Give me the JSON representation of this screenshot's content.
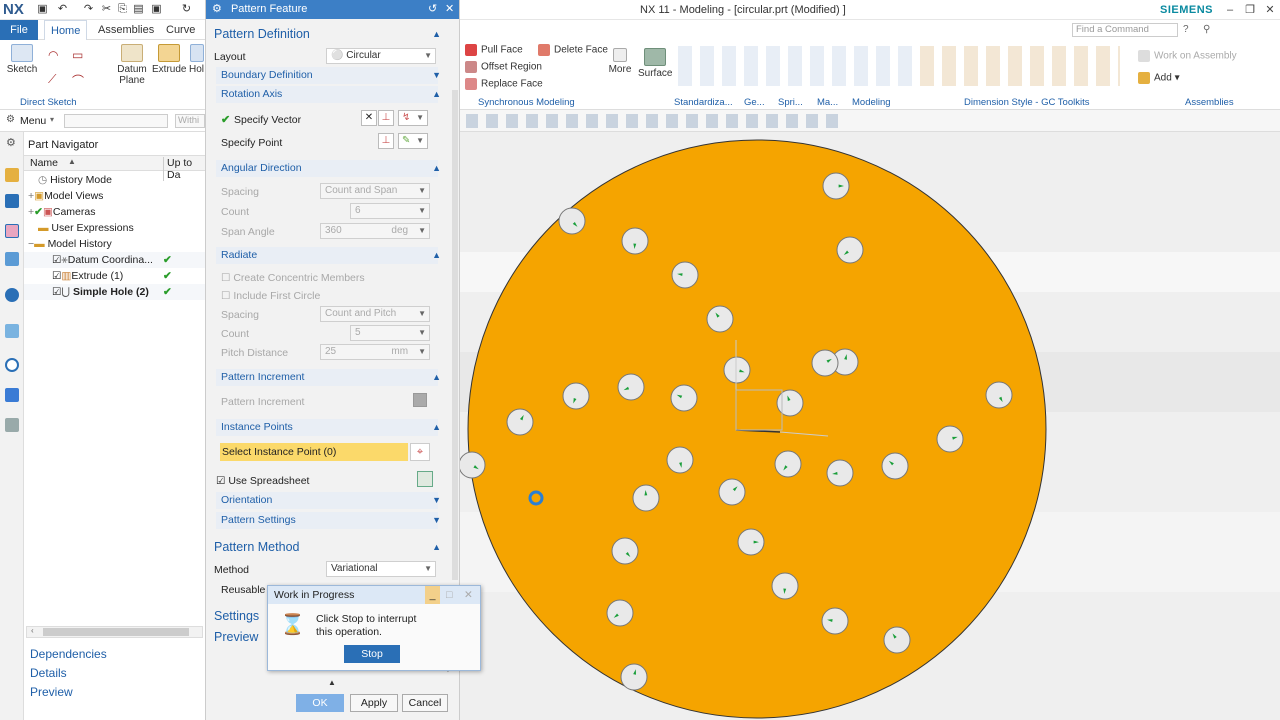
{
  "app": {
    "logo": "NX",
    "title": "NX 11 - Modeling - [circular.prt (Modified) ]",
    "brand": "SIEMENS",
    "find_placeholder": "Find a Command"
  },
  "ribbon_tabs": {
    "file": "File",
    "home": "Home",
    "assemblies": "Assemblies",
    "curve": "Curve"
  },
  "ribbon_left": {
    "sketch": "Sketch",
    "datum_plane": "Datum Plane",
    "extrude": "Extrude",
    "hole": "Hol",
    "group_direct_sketch": "Direct Sketch"
  },
  "ribbon_right": {
    "pull_face": "Pull Face",
    "delete_face": "Delete Face",
    "offset_region": "Offset Region",
    "replace_face": "Replace Face",
    "more": "More",
    "surface": "Surface",
    "work_on_assembly": "Work on Assembly",
    "add": "Add",
    "groups": [
      "Synchronous Modeling",
      "Standardiza...",
      "Ge...",
      "Spri...",
      "Ma...",
      "Modeling",
      "Dimension Style - GC Toolkits",
      "Assemblies"
    ]
  },
  "menubar": {
    "menu": "Menu",
    "within": "Withi"
  },
  "navigator": {
    "title": "Part Navigator",
    "col_name": "Name",
    "col_uptodate": "Up to Da",
    "rows": [
      {
        "label": "History Mode"
      },
      {
        "label": "Model Views"
      },
      {
        "label": "Cameras"
      },
      {
        "label": "User Expressions"
      },
      {
        "label": "Model History"
      },
      {
        "label": "Datum Coordina..."
      },
      {
        "label": "Extrude (1)"
      },
      {
        "label": "Simple Hole (2)"
      }
    ],
    "dependencies": "Dependencies",
    "details": "Details",
    "preview": "Preview"
  },
  "dialog": {
    "title": "Pattern Feature",
    "pattern_definition": "Pattern Definition",
    "layout_label": "Layout",
    "layout_value": "Circular",
    "boundary_definition": "Boundary Definition",
    "rotation_axis": "Rotation Axis",
    "specify_vector": "Specify Vector",
    "specify_point": "Specify Point",
    "angular_direction": "Angular Direction",
    "spacing_label": "Spacing",
    "spacing_value": "Count and Span",
    "count_label": "Count",
    "count_value": "6",
    "span_angle_label": "Span Angle",
    "span_angle_value": "360",
    "span_angle_unit": "deg",
    "radiate": "Radiate",
    "create_concentric": "Create Concentric Members",
    "include_first_circle": "Include First Circle",
    "radiate_spacing_label": "Spacing",
    "radiate_spacing_value": "Count and Pitch",
    "radiate_count_label": "Count",
    "radiate_count_value": "5",
    "pitch_distance_label": "Pitch Distance",
    "pitch_distance_value": "25",
    "pitch_distance_unit": "mm",
    "pattern_increment_head": "Pattern Increment",
    "pattern_increment_row": "Pattern Increment",
    "instance_points": "Instance Points",
    "select_instance_point": "Select Instance Point (0)",
    "use_spreadsheet": "Use Spreadsheet",
    "orientation": "Orientation",
    "pattern_settings": "Pattern Settings",
    "pattern_method": "Pattern Method",
    "method_label": "Method",
    "method_value": "Variational",
    "reusable": "Reusable R",
    "settings": "Settings",
    "preview": "Preview",
    "ok": "OK",
    "apply": "Apply",
    "cancel": "Cancel"
  },
  "wip": {
    "title": "Work in Progress",
    "message_line1": "Click Stop to interrupt",
    "message_line2": "this operation.",
    "stop": "Stop"
  },
  "colors": {
    "part_fill": "#f5a400",
    "accent": "#2a6fb6",
    "highlight": "#fbd96a",
    "marker": "#1a9e3a"
  }
}
